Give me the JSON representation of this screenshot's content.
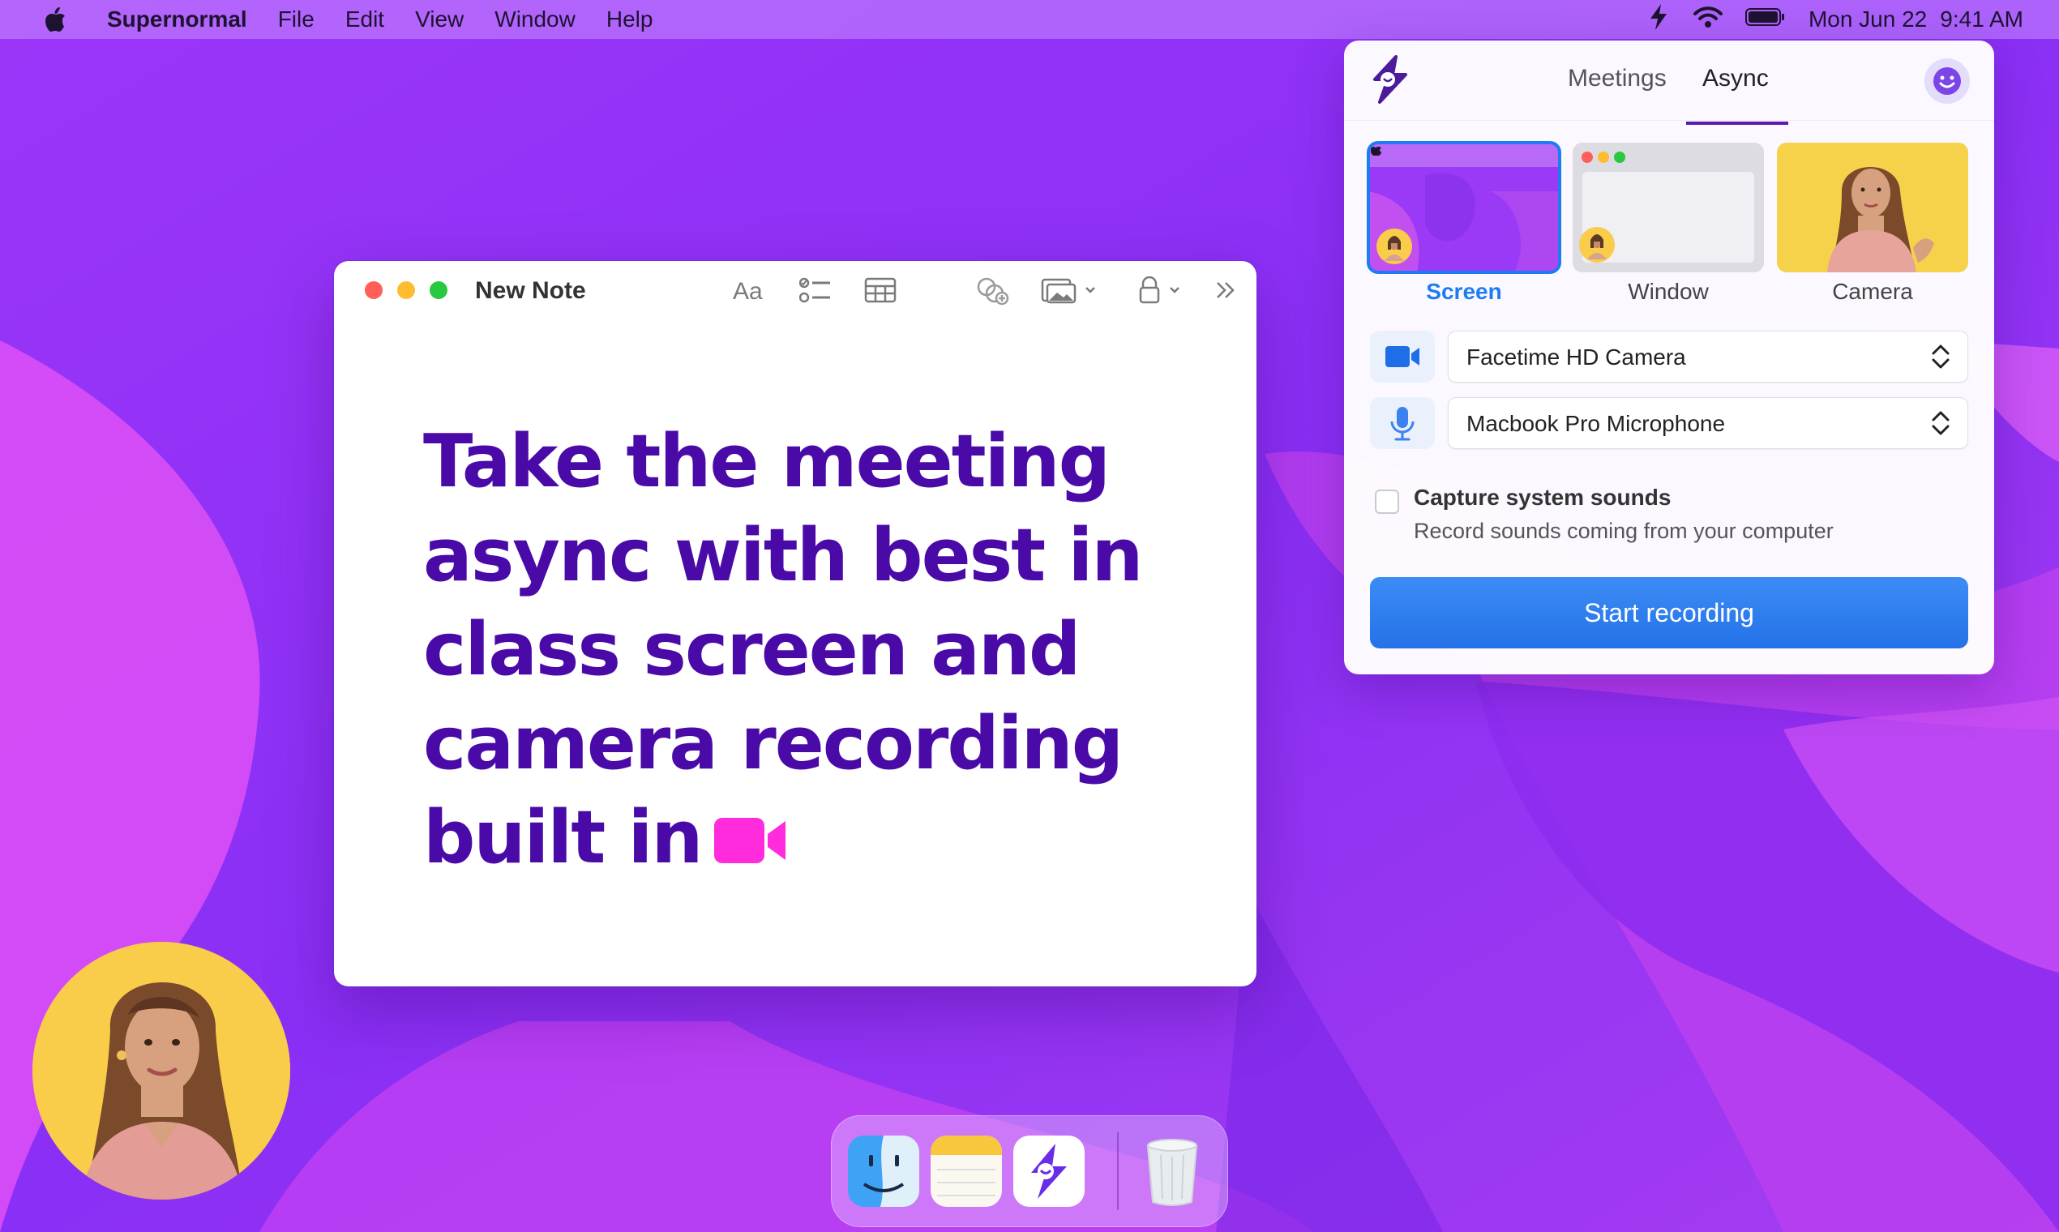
{
  "menubar": {
    "app_name": "Supernormal",
    "menus": [
      "File",
      "Edit",
      "View",
      "Window",
      "Help"
    ],
    "date": "Mon Jun 22",
    "time": "9:41 AM"
  },
  "note": {
    "title": "New Note",
    "toolbar_icons": [
      "text-format-icon",
      "checklist-icon",
      "table-icon",
      "collaborate-icon",
      "media-icon",
      "lock-icon",
      "more-icon"
    ],
    "body_text": "Take the meeting async with best in class screen and camera recording built in"
  },
  "panel": {
    "tabs": {
      "meetings": "Meetings",
      "async": "Async"
    },
    "active_tab": "Async",
    "sources": {
      "screen": "Screen",
      "window": "Window",
      "camera": "Camera"
    },
    "selected_source": "Screen",
    "camera_device": "Facetime HD Camera",
    "mic_device": "Macbook Pro Microphone",
    "capture": {
      "title": "Capture system sounds",
      "subtitle": "Record sounds coming from your computer",
      "checked": false
    },
    "start_label": "Start recording"
  },
  "dock": {
    "apps": [
      "Finder",
      "Notes",
      "Supernormal",
      "Trash"
    ]
  },
  "colors": {
    "accent": "#1e7cf2",
    "headline": "#4a0aa8",
    "brand": "#5b1bb0",
    "camera_bg": "#f9cc4a",
    "highlight_pink": "#ff2bdc"
  }
}
